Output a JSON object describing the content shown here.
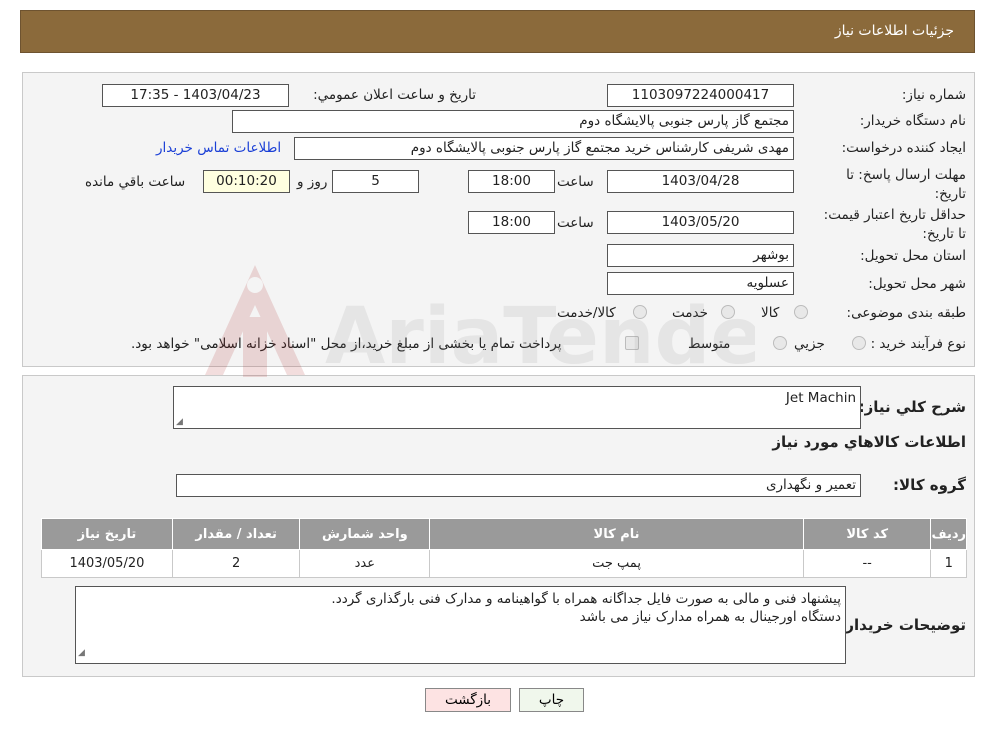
{
  "header": {
    "title": "جزئیات اطلاعات نیاز"
  },
  "form": {
    "need_number": {
      "label": "شماره نیاز:",
      "value": "1103097224000417"
    },
    "announce_datetime": {
      "label": "تاریخ و ساعت اعلان عمومي:",
      "value": "1403/04/23 - 17:35"
    },
    "buyer_org": {
      "label": "نام دستگاه خریدار:",
      "value": "مجتمع گاز پارس جنوبی  پالایشگاه دوم"
    },
    "requester": {
      "label": "ایجاد کننده درخواست:",
      "value": "مهدی شریفی کارشناس خرید مجتمع گاز پارس جنوبی  پالایشگاه دوم"
    },
    "contact_link": "اطلاعات تماس خریدار",
    "deadline": {
      "label": "مهلت ارسال پاسخ: تا تاریخ:",
      "date": "1403/04/28",
      "time_label": "ساعت",
      "time": "18:00",
      "days": "5",
      "days_label": "روز و",
      "remaining": "00:10:20",
      "remaining_label": "ساعت باقي مانده"
    },
    "price_validity": {
      "label": "حداقل تاریخ اعتبار قیمت: تا تاریخ:",
      "date": "1403/05/20",
      "time_label": "ساعت",
      "time": "18:00"
    },
    "province": {
      "label": "استان محل تحویل:",
      "value": "بوشهر"
    },
    "city": {
      "label": "شهر محل تحویل:",
      "value": "عسلویه"
    },
    "category": {
      "label": "طبقه بندی موضوعی:",
      "options": [
        "کالا",
        "خدمت",
        "کالا/خدمت"
      ]
    },
    "process": {
      "label": "نوع فرآیند خرید :",
      "options": [
        "جزیي",
        "متوسط"
      ],
      "note": "پرداخت تمام یا بخشی از مبلغ خرید،از محل \"اسناد خزانه اسلامی\" خواهد بود."
    }
  },
  "details": {
    "summary_label": "شرح کلي نياز:",
    "summary_value": "Jet Machin",
    "goods_title": "اطلاعات کالاهاي مورد نياز",
    "group_label": "گروه کالا:",
    "group_value": "تعمیر و نگهداری",
    "table": {
      "headers": [
        "رديف",
        "کد کالا",
        "نام کالا",
        "واحد شمارش",
        "تعداد / مقدار",
        "تاریخ نیاز"
      ],
      "rows": [
        [
          "1",
          "--",
          "پمپ جت",
          "عدد",
          "2",
          "1403/05/20"
        ]
      ]
    },
    "buyer_notes_label": "توضیحات خریدار:",
    "buyer_notes": [
      "پیشنهاد فنی و مالی به صورت فایل جداگانه همراه با گواهینامه و مدارک فنی بارگذاری گردد.",
      "دستگاه اورجینال به همراه مدارک نیاز می باشد"
    ]
  },
  "buttons": {
    "print": "چاپ",
    "back": "بازگشت"
  },
  "colors": {
    "header": "#8b6a3b",
    "table_header": "#9a9a9a",
    "back_button": "#fde3e3",
    "link": "#1a3fd6"
  }
}
